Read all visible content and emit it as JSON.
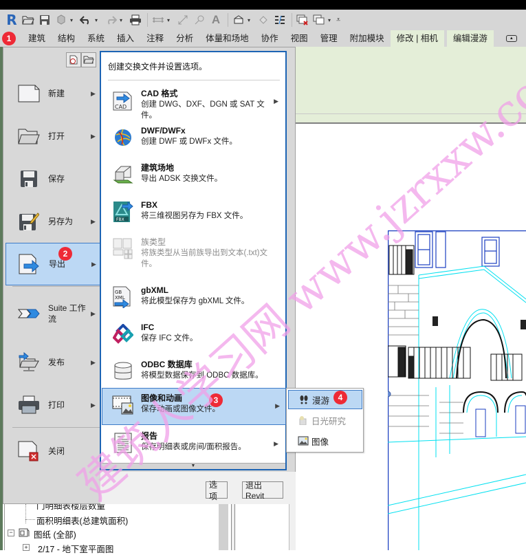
{
  "app": {
    "logo": "R",
    "quick_access": {
      "icons": [
        "revit-logo-icon",
        "open-icon",
        "save-icon",
        "sync-icon",
        "undo-icon",
        "redo-icon",
        "print-icon",
        "measure-icon",
        "dimension-icon",
        "tag-icon",
        "text-icon",
        "3d-view-icon",
        "section-icon",
        "thin-lines-icon",
        "close-hidden-windows-icon",
        "switch-windows-icon",
        "customize-icon"
      ]
    }
  },
  "ribbon": {
    "tabs": [
      {
        "label": "建筑"
      },
      {
        "label": "结构"
      },
      {
        "label": "系统"
      },
      {
        "label": "插入"
      },
      {
        "label": "注释"
      },
      {
        "label": "分析"
      },
      {
        "label": "体量和场地"
      },
      {
        "label": "协作"
      },
      {
        "label": "视图"
      },
      {
        "label": "管理"
      },
      {
        "label": "附加模块"
      },
      {
        "label": "修改 | 相机",
        "contextual": true
      },
      {
        "label": "编辑漫游",
        "contextual": true
      }
    ]
  },
  "badges": {
    "b1": "1",
    "b2": "2",
    "b3": "3",
    "b4": "4",
    "color": "#ee2a36"
  },
  "app_menu": {
    "recent_icons": [
      "recent-documents-icon",
      "open-documents-icon"
    ],
    "items": [
      {
        "label": "新建",
        "icon": "new-document-icon",
        "submenu": true
      },
      {
        "label": "打开",
        "icon": "open-folder-icon",
        "submenu": true
      },
      {
        "label": "保存",
        "icon": "save-icon",
        "submenu": false
      },
      {
        "label": "另存为",
        "icon": "save-as-icon",
        "submenu": true
      },
      {
        "label": "导出",
        "icon": "export-icon",
        "submenu": true,
        "selected": true
      },
      {
        "label": "Suite 工作流",
        "icon": "suite-workflow-icon",
        "submenu": true
      },
      {
        "label": "发布",
        "icon": "publish-icon",
        "submenu": true
      },
      {
        "label": "打印",
        "icon": "print-icon",
        "submenu": true
      },
      {
        "label": "关闭",
        "icon": "close-document-icon",
        "submenu": false
      }
    ],
    "options_button": "选项",
    "exit_button": "退出 Revit"
  },
  "export_menu": {
    "header": "创建交换文件并设置选项。",
    "items": [
      {
        "title": "CAD 格式",
        "desc": "创建 DWG、DXF、DGN 或 SAT 文件。",
        "icon": "cad-export-icon",
        "submenu": true
      },
      {
        "title": "DWF/DWFx",
        "desc": "创建 DWF 或 DWFx 文件。",
        "icon": "dwf-globe-icon",
        "submenu": false
      },
      {
        "title": "建筑场地",
        "desc": "导出 ADSK 交换文件。",
        "icon": "building-site-icon",
        "submenu": false
      },
      {
        "title": "FBX",
        "desc": "将三维视图另存为 FBX 文件。",
        "icon": "fbx-icon",
        "submenu": false
      },
      {
        "title": "族类型",
        "desc": "将族类型从当前族导出到文本(.txt)文件。",
        "icon": "family-types-icon",
        "submenu": false,
        "disabled": true
      },
      {
        "title": "gbXML",
        "desc": "将此模型保存为 gbXML 文件。",
        "icon": "gbxml-icon",
        "submenu": false
      },
      {
        "title": "IFC",
        "desc": "保存 IFC 文件。",
        "icon": "ifc-icon",
        "submenu": false
      },
      {
        "title": "ODBC 数据库",
        "desc": "将模型数据保存到 ODBC 数据库。",
        "icon": "database-icon",
        "submenu": false
      },
      {
        "title": "图像和动画",
        "desc": "保存动画或图像文件。",
        "icon": "image-animation-icon",
        "submenu": true,
        "selected": true
      },
      {
        "title": "报告",
        "desc": "保存明细表或房间/面积报告。",
        "icon": "report-icon",
        "submenu": true
      }
    ]
  },
  "image_flyout": {
    "items": [
      {
        "label": "漫游",
        "icon": "walkthrough-footprints-icon",
        "selected": true
      },
      {
        "label": "日光研究",
        "icon": "solar-study-icon",
        "disabled": true
      },
      {
        "label": "图像",
        "icon": "image-icon"
      }
    ]
  },
  "project_browser": {
    "items": [
      {
        "label": "门明细表楼层数量",
        "partial": true
      },
      {
        "label": "面积明细表(总建筑面积)"
      },
      {
        "label": "图纸 (全部)",
        "expanded": true
      },
      {
        "label": "2/17 - 地下室平面图",
        "partial": true
      }
    ]
  },
  "watermark": {
    "text": "建筑人学习网 www.jzrxxw.com",
    "color": "#f0a0e8"
  }
}
